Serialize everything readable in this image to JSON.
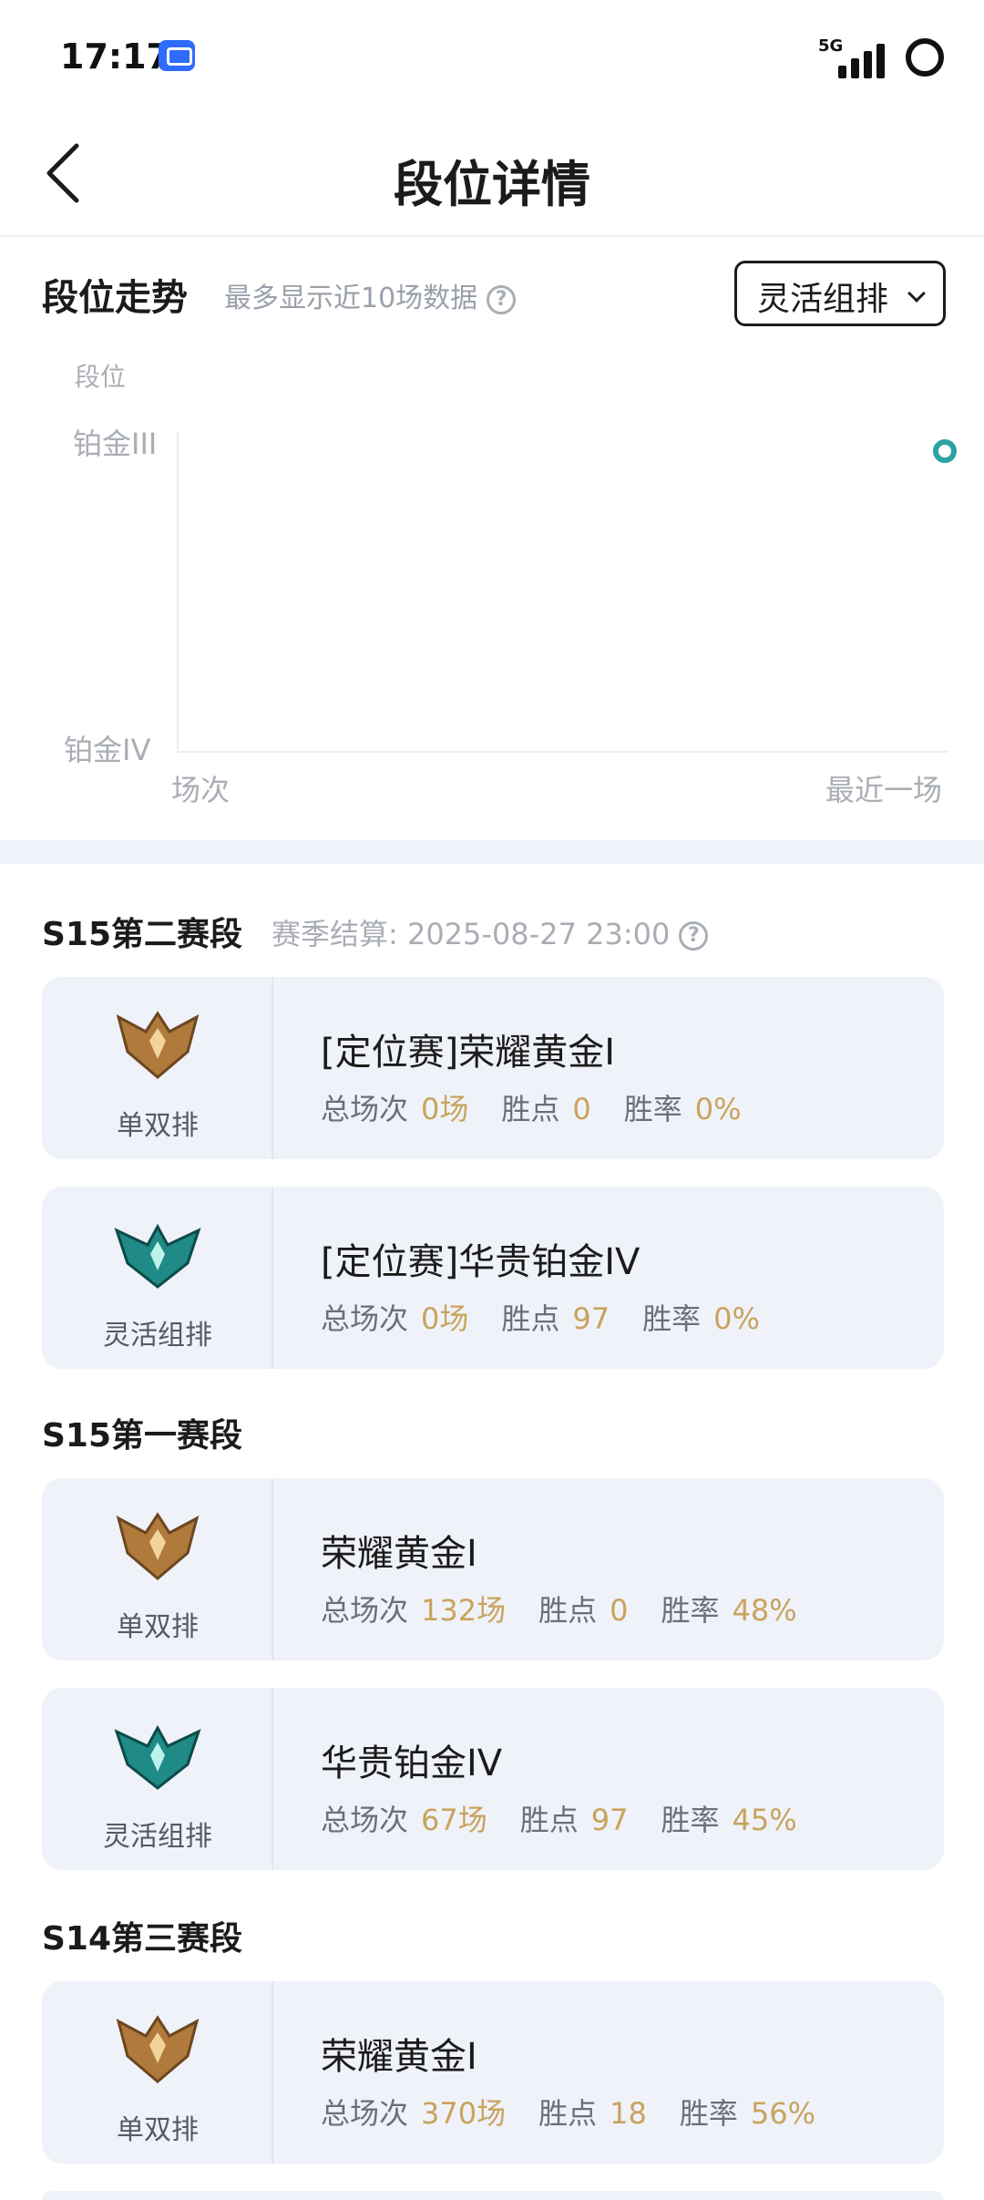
{
  "status_bar": {
    "time": "17:17",
    "network": "5G",
    "app_badge_icon": "delivery-app-icon"
  },
  "nav": {
    "title": "段位详情",
    "back_icon": "chevron-left-icon"
  },
  "trend": {
    "title": "段位走势",
    "subtitle": "最多显示近10场数据",
    "help_icon": "question-circle-icon",
    "mode_select": "灵活组排"
  },
  "chart_data": {
    "type": "line",
    "ylabel": "段位",
    "y_ticks": [
      "铂金III",
      "铂金IV"
    ],
    "x_ticks": [
      "场次",
      "最近一场"
    ],
    "series": [
      {
        "values": [
          "铂金III"
        ]
      }
    ],
    "point_color": "#2ba3a3"
  },
  "seasons": [
    {
      "name": "S15第二赛段",
      "settle_label": "赛季结算: 2025-08-27 23:00",
      "cards": [
        {
          "queue": "单双排",
          "emblem": "gold",
          "rank": "[定位赛]荣耀黄金I",
          "games_label": "总场次",
          "games": "0场",
          "lp_label": "胜点",
          "lp": "0",
          "wr_label": "胜率",
          "wr": "0%"
        },
        {
          "queue": "灵活组排",
          "emblem": "platinum",
          "rank": "[定位赛]华贵铂金IV",
          "games_label": "总场次",
          "games": "0场",
          "lp_label": "胜点",
          "lp": "97",
          "wr_label": "胜率",
          "wr": "0%"
        }
      ]
    },
    {
      "name": "S15第一赛段",
      "cards": [
        {
          "queue": "单双排",
          "emblem": "gold",
          "rank": "荣耀黄金I",
          "games_label": "总场次",
          "games": "132场",
          "lp_label": "胜点",
          "lp": "0",
          "wr_label": "胜率",
          "wr": "48%"
        },
        {
          "queue": "灵活组排",
          "emblem": "platinum",
          "rank": "华贵铂金IV",
          "games_label": "总场次",
          "games": "67场",
          "lp_label": "胜点",
          "lp": "97",
          "wr_label": "胜率",
          "wr": "45%"
        }
      ]
    },
    {
      "name": "S14第三赛段",
      "cards": [
        {
          "queue": "单双排",
          "emblem": "gold",
          "rank": "荣耀黄金I",
          "games_label": "总场次",
          "games": "370场",
          "lp_label": "胜点",
          "lp": "18",
          "wr_label": "胜率",
          "wr": "56%"
        }
      ]
    }
  ],
  "colors": {
    "accent_value": "#c9a35d",
    "card_bg": "#eff2f8",
    "gold_emblem": "#b07a3c",
    "platinum_emblem": "#1f8a86"
  }
}
